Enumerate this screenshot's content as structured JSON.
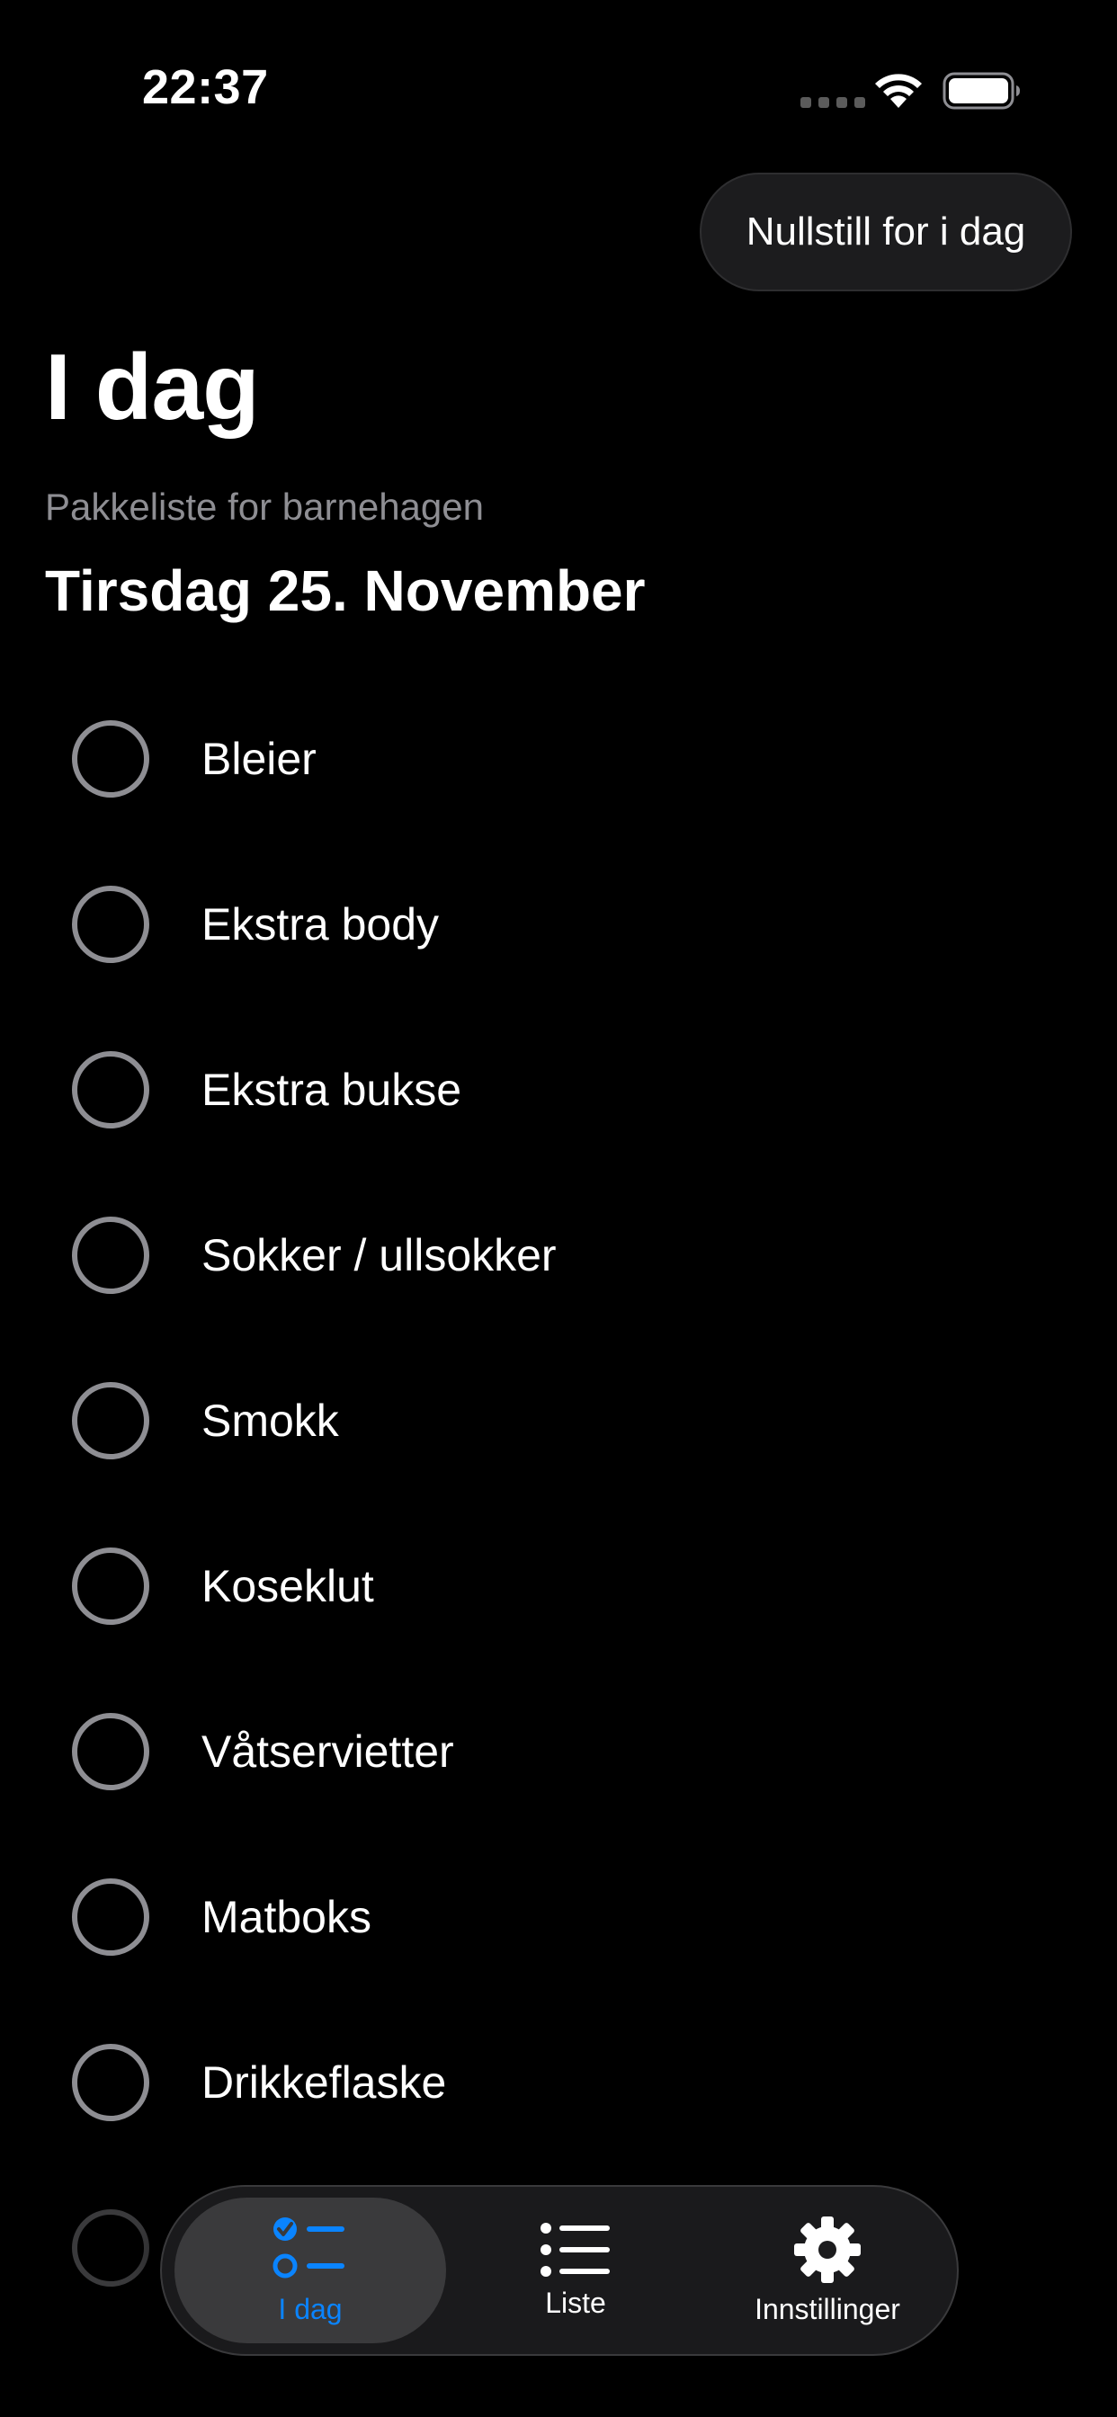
{
  "status_bar": {
    "time": "22:37"
  },
  "header": {
    "reset_button_label": "Nullstill for i dag",
    "title": "I dag",
    "subtitle": "Pakkeliste for barnehagen",
    "date": "Tirsdag 25. November"
  },
  "checklist": {
    "items": [
      {
        "label": "Bleier",
        "checked": false
      },
      {
        "label": "Ekstra body",
        "checked": false
      },
      {
        "label": "Ekstra bukse",
        "checked": false
      },
      {
        "label": "Sokker / ullsokker",
        "checked": false
      },
      {
        "label": "Smokk",
        "checked": false
      },
      {
        "label": "Koseklut",
        "checked": false
      },
      {
        "label": "Våtservietter",
        "checked": false
      },
      {
        "label": "Matboks",
        "checked": false
      },
      {
        "label": "Drikkeflaske",
        "checked": false
      },
      {
        "label": "",
        "checked": false
      }
    ]
  },
  "tab_bar": {
    "tabs": [
      {
        "label": "I dag",
        "icon": "checklist-icon",
        "selected": true
      },
      {
        "label": "Liste",
        "icon": "list-icon",
        "selected": false
      },
      {
        "label": "Innstillinger",
        "icon": "gear-icon",
        "selected": false
      }
    ]
  },
  "colors": {
    "accent": "#0a84ff",
    "background": "#000000",
    "secondary_text": "#8e8e93",
    "circle_stroke": "#8e8e93"
  }
}
